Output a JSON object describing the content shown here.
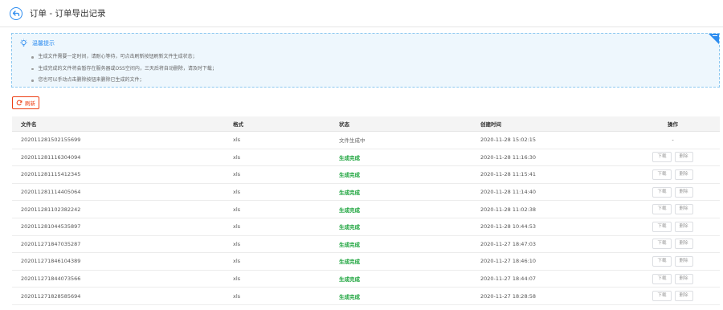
{
  "header": {
    "title": "订单 - 订单导出记录"
  },
  "tips": {
    "title": "温馨提示",
    "items": [
      "生成文件需要一定时间，请耐心等待，可点击刷新按钮刷新文件生成状态；",
      "生成完成的文件将会暂存在服务器或OSS空间内，三天后将自动删除，请及时下载；",
      "您也可以手动点击删除按钮来删除已生成的文件；"
    ]
  },
  "toolbar": {
    "refresh_label": "刷新"
  },
  "table": {
    "columns": [
      "文件名",
      "格式",
      "状态",
      "创建时间",
      "操作"
    ],
    "download_label": "下载",
    "delete_label": "删除",
    "rows": [
      {
        "name": "202011281502155699",
        "format": "xls",
        "status": "文件生成中",
        "done": false,
        "created": "2020-11-28 15:02:15",
        "ops": "-"
      },
      {
        "name": "202011281116304094",
        "format": "xls",
        "status": "生成完成",
        "done": true,
        "created": "2020-11-28 11:16:30"
      },
      {
        "name": "202011281115412345",
        "format": "xls",
        "status": "生成完成",
        "done": true,
        "created": "2020-11-28 11:15:41"
      },
      {
        "name": "202011281114405064",
        "format": "xls",
        "status": "生成完成",
        "done": true,
        "created": "2020-11-28 11:14:40"
      },
      {
        "name": "202011281102382242",
        "format": "xls",
        "status": "生成完成",
        "done": true,
        "created": "2020-11-28 11:02:38"
      },
      {
        "name": "202011281044535897",
        "format": "xls",
        "status": "生成完成",
        "done": true,
        "created": "2020-11-28 10:44:53"
      },
      {
        "name": "202011271847035287",
        "format": "xls",
        "status": "生成完成",
        "done": true,
        "created": "2020-11-27 18:47:03"
      },
      {
        "name": "202011271846104389",
        "format": "xls",
        "status": "生成完成",
        "done": true,
        "created": "2020-11-27 18:46:10"
      },
      {
        "name": "202011271844073566",
        "format": "xls",
        "status": "生成完成",
        "done": true,
        "created": "2020-11-27 18:44:07"
      },
      {
        "name": "202011271828585694",
        "format": "xls",
        "status": "生成完成",
        "done": true,
        "created": "2020-11-27 18:28:58"
      }
    ]
  },
  "colors": {
    "accent": "#2d8cf0",
    "danger": "#ed4014",
    "success": "#19a33a"
  },
  "icons": {
    "back": "back-arrow-icon",
    "tip": "lightbulb-icon",
    "refresh": "refresh-icon"
  }
}
